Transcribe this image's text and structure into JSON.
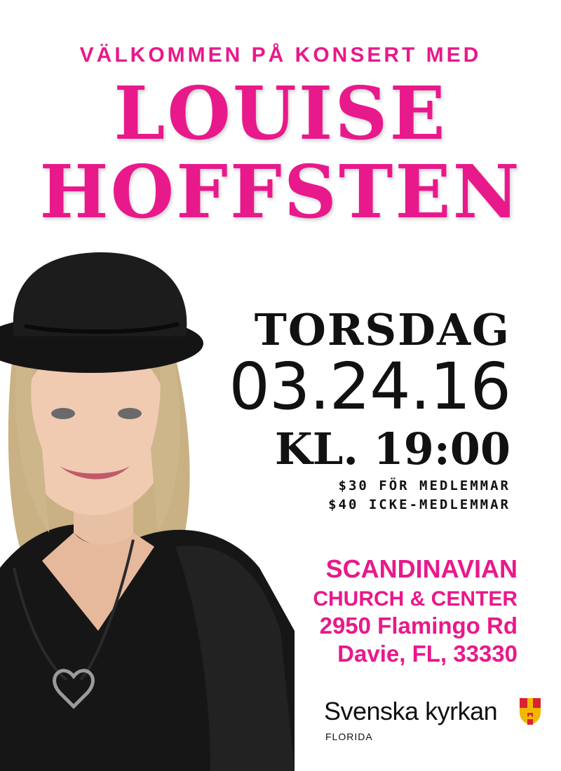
{
  "poster": {
    "subtitle": "VÄLKOMMEN PÅ KONSERT MED",
    "name_line1": "LOUISE",
    "name_line2": "HOFFSTEN",
    "day": "TORSDAG",
    "date": "03.24.16",
    "time": "KL. 19:00",
    "price_members": "$30 FÖR MEDLEMMAR",
    "price_nonmembers": "$40 ICKE-MEDLEMMAR"
  },
  "venue": {
    "line1": "SCANDINAVIAN",
    "line2": "CHURCH & CENTER",
    "line3": "2950 Flamingo Rd",
    "line4": "Davie, FL, 33330"
  },
  "logo": {
    "name": "Svenska kyrkan",
    "region": "FLORIDA",
    "icon": "church-shield-icon"
  },
  "colors": {
    "accent": "#e8198b",
    "text": "#111111",
    "background": "#ffffff"
  }
}
